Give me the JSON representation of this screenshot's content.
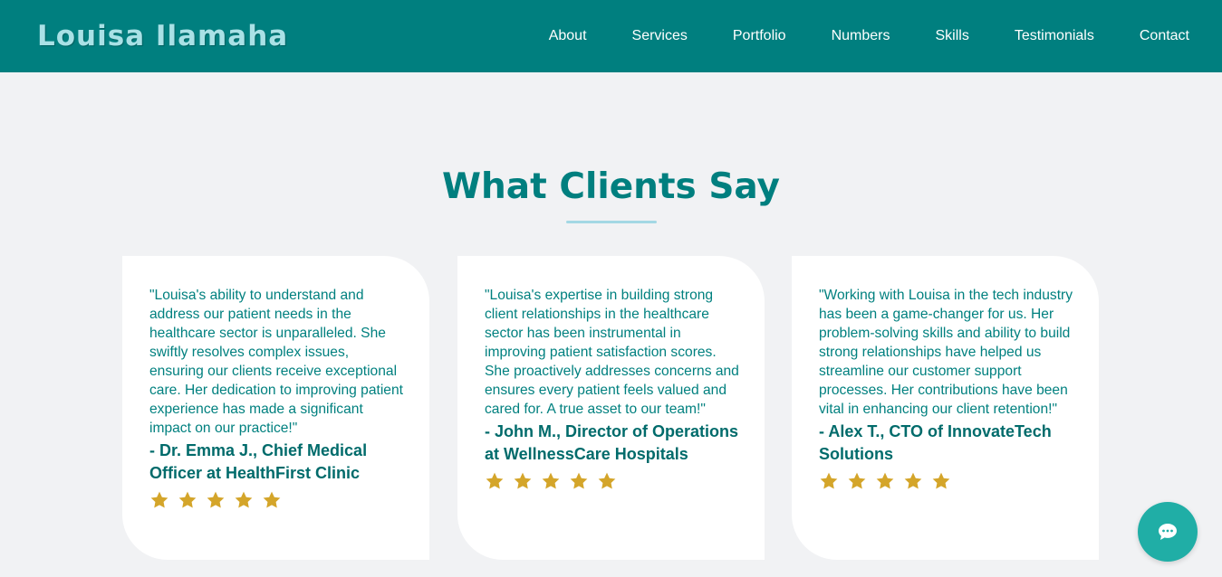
{
  "header": {
    "brand": "Louisa Ilamaha",
    "nav": [
      "About",
      "Services",
      "Portfolio",
      "Numbers",
      "Skills",
      "Testimonials",
      "Contact"
    ]
  },
  "testimonials": {
    "title": "What Clients Say",
    "items": [
      {
        "quote": "\"Louisa's ability to understand and address our patient needs in the healthcare sector is unparalleled. She swiftly resolves complex issues, ensuring our clients receive exceptional care. Her dedication to improving patient experience has made a significant impact on our practice!\"",
        "author": "- Dr. Emma J., Chief Medical Officer at HealthFirst Clinic",
        "rating": 5
      },
      {
        "quote": "\"Louisa's expertise in building strong client relationships in the healthcare sector has been instrumental in improving patient satisfaction scores. She proactively addresses concerns and ensures every patient feels valued and cared for. A true asset to our team!\"",
        "author": "- John M., Director of Operations at WellnessCare Hospitals",
        "rating": 5
      },
      {
        "quote": "\"Working with Louisa in the tech industry has been a game-changer for us. Her problem-solving skills and ability to build strong relationships have helped us streamline our customer support processes. Her contributions have been vital in enhancing our client retention!\"",
        "author": "- Alex T., CTO of InnovateTech Solutions",
        "rating": 5
      }
    ]
  },
  "icons": {
    "star": "star-icon",
    "chat": "chat-bubble-icon"
  },
  "colors": {
    "header_bg": "#007f7f",
    "brand": "#a9e1e6",
    "accent": "#007f7f",
    "star": "#d4a52a",
    "chat_button": "#20aea6"
  }
}
